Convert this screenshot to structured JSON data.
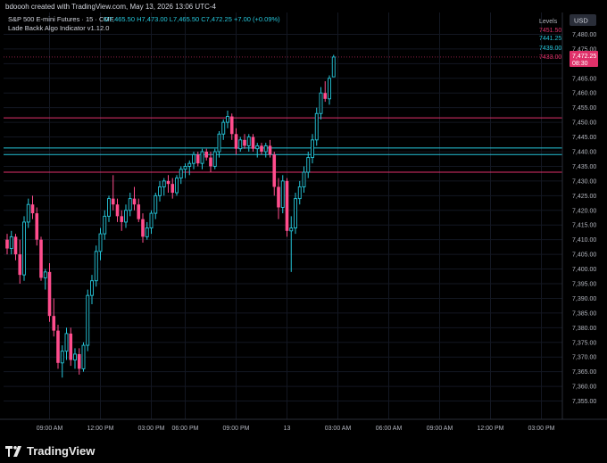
{
  "header": {
    "credit": "bdoooh created with TradingView.com, May 13, 2026 13:06 UTC-4"
  },
  "legend": {
    "symbol": "S&P 500 E-mini Futures · 15 · CME",
    "ohlc": "O7,465.50  H7,473.00  L7,465.50  C7,472.25  +7.00 (+0.09%)",
    "indicator": "Lade Backk Algo Indicator v1.12.0"
  },
  "scale": {
    "currency": "USD",
    "levels_title": "Levels"
  },
  "colors": {
    "up": "#26c6da",
    "down": "#ff4d8d",
    "magenta_level": "#e0316a",
    "teal_level": "#26c6da",
    "bg": "#000000"
  },
  "levels": [
    {
      "label": "7451.50",
      "value": 7451.5,
      "color": "#e0316a"
    },
    {
      "label": "7441.25",
      "value": 7441.25,
      "color": "#26c6da"
    },
    {
      "label": "7439.00",
      "value": 7439.0,
      "color": "#26c6da"
    },
    {
      "label": "7433.00",
      "value": 7433.0,
      "color": "#e0316a"
    }
  ],
  "last_price": {
    "label": "7,472.25",
    "countdown": "08:30"
  },
  "brand": {
    "name": "TradingView"
  },
  "chart_data": {
    "type": "candlestick",
    "ylim": [
      7350,
      7485
    ],
    "y_ticks": [
      7355,
      7360,
      7365,
      7370,
      7375,
      7380,
      7385,
      7390,
      7395,
      7400,
      7405,
      7410,
      7415,
      7420,
      7425,
      7430,
      7435,
      7440,
      7445,
      7450,
      7455,
      7460,
      7465,
      7470,
      7475,
      7480
    ],
    "y_tick_labels": [
      "7,355.00",
      "7,360.00",
      "7,365.00",
      "7,370.00",
      "7,375.00",
      "7,380.00",
      "7,385.00",
      "7,390.00",
      "7,395.00",
      "7,400.00",
      "7,405.00",
      "7,410.00",
      "7,415.00",
      "7,420.00",
      "7,425.00",
      "7,430.00",
      "7,435.00",
      "7,440.00",
      "7,445.00",
      "7,450.00",
      "7,455.00",
      "7,460.00",
      "7,465.00",
      "7,470.00",
      "7,475.00",
      "7,480.00"
    ],
    "x_ticks": [
      {
        "index": 10,
        "label": "09:00 AM"
      },
      {
        "index": 22,
        "label": "12:00 PM"
      },
      {
        "index": 34,
        "label": "03:00 PM"
      },
      {
        "index": 42,
        "label": "06:00 PM"
      },
      {
        "index": 54,
        "label": "09:00 PM"
      },
      {
        "index": 66,
        "label": "13"
      },
      {
        "index": 78,
        "label": "03:00 AM"
      },
      {
        "index": 90,
        "label": "06:00 AM"
      },
      {
        "index": 102,
        "label": "09:00 AM"
      },
      {
        "index": 114,
        "label": "12:00 PM"
      },
      {
        "index": 126,
        "label": "03:00 PM"
      }
    ],
    "candles": [
      [
        7410,
        7412,
        7405,
        7407
      ],
      [
        7407,
        7413,
        7405,
        7411
      ],
      [
        7411,
        7412,
        7403,
        7405
      ],
      [
        7405,
        7410,
        7395,
        7398
      ],
      [
        7398,
        7418,
        7396,
        7416
      ],
      [
        7416,
        7424,
        7414,
        7422
      ],
      [
        7422,
        7425,
        7417,
        7419
      ],
      [
        7419,
        7421,
        7408,
        7410
      ],
      [
        7410,
        7411,
        7396,
        7397
      ],
      [
        7397,
        7400,
        7393,
        7399
      ],
      [
        7399,
        7402,
        7382,
        7384
      ],
      [
        7384,
        7390,
        7377,
        7379
      ],
      [
        7379,
        7381,
        7366,
        7368
      ],
      [
        7368,
        7374,
        7363,
        7372
      ],
      [
        7372,
        7380,
        7369,
        7378
      ],
      [
        7378,
        7380,
        7367,
        7369
      ],
      [
        7369,
        7373,
        7366,
        7371
      ],
      [
        7371,
        7373,
        7364,
        7366
      ],
      [
        7366,
        7375,
        7365,
        7374
      ],
      [
        7374,
        7393,
        7372,
        7391
      ],
      [
        7391,
        7398,
        7388,
        7396
      ],
      [
        7396,
        7408,
        7394,
        7406
      ],
      [
        7406,
        7414,
        7403,
        7412
      ],
      [
        7412,
        7420,
        7410,
        7418
      ],
      [
        7418,
        7425,
        7416,
        7424
      ],
      [
        7424,
        7432,
        7420,
        7422
      ],
      [
        7422,
        7424,
        7416,
        7418
      ],
      [
        7418,
        7420,
        7413,
        7416
      ],
      [
        7416,
        7422,
        7414,
        7420
      ],
      [
        7420,
        7426,
        7418,
        7424
      ],
      [
        7424,
        7428,
        7420,
        7422
      ],
      [
        7422,
        7424,
        7416,
        7417
      ],
      [
        7417,
        7419,
        7409,
        7411
      ],
      [
        7411,
        7416,
        7410,
        7414
      ],
      [
        7414,
        7420,
        7412,
        7419
      ],
      [
        7419,
        7426,
        7417,
        7425
      ],
      [
        7425,
        7430,
        7423,
        7428
      ],
      [
        7428,
        7431,
        7425,
        7430
      ],
      [
        7430,
        7432,
        7426,
        7429
      ],
      [
        7429,
        7431,
        7424,
        7426
      ],
      [
        7426,
        7432,
        7425,
        7431
      ],
      [
        7431,
        7435,
        7429,
        7434
      ],
      [
        7434,
        7436,
        7431,
        7435
      ],
      [
        7435,
        7437,
        7432,
        7436
      ],
      [
        7436,
        7440,
        7434,
        7439
      ],
      [
        7439,
        7440,
        7435,
        7436
      ],
      [
        7436,
        7441,
        7434,
        7440
      ],
      [
        7440,
        7441,
        7437,
        7438
      ],
      [
        7438,
        7440,
        7433,
        7435
      ],
      [
        7435,
        7441,
        7434,
        7440
      ],
      [
        7440,
        7447,
        7438,
        7446
      ],
      [
        7446,
        7451,
        7444,
        7450
      ],
      [
        7450,
        7454,
        7448,
        7452
      ],
      [
        7452,
        7453,
        7444,
        7446
      ],
      [
        7446,
        7448,
        7439,
        7441
      ],
      [
        7441,
        7445,
        7440,
        7444
      ],
      [
        7444,
        7446,
        7441,
        7442
      ],
      [
        7442,
        7446,
        7440,
        7445
      ],
      [
        7445,
        7446,
        7440,
        7441
      ],
      [
        7441,
        7443,
        7438,
        7442
      ],
      [
        7442,
        7443,
        7439,
        7440
      ],
      [
        7440,
        7443,
        7438,
        7442
      ],
      [
        7442,
        7444,
        7438,
        7439
      ],
      [
        7439,
        7440,
        7425,
        7428
      ],
      [
        7428,
        7431,
        7417,
        7421
      ],
      [
        7421,
        7432,
        7419,
        7430
      ],
      [
        7430,
        7431,
        7411,
        7413
      ],
      [
        7413,
        7418,
        7399,
        7414
      ],
      [
        7414,
        7426,
        7412,
        7424
      ],
      [
        7424,
        7430,
        7422,
        7428
      ],
      [
        7428,
        7435,
        7426,
        7433
      ],
      [
        7433,
        7440,
        7431,
        7438
      ],
      [
        7438,
        7446,
        7436,
        7444
      ],
      [
        7444,
        7455,
        7442,
        7453
      ],
      [
        7453,
        7462,
        7451,
        7460
      ],
      [
        7460,
        7464,
        7457,
        7458
      ],
      [
        7458,
        7466,
        7456,
        7465
      ],
      [
        7465.5,
        7473,
        7465.5,
        7472.25
      ]
    ],
    "candle_x_index": [
      0,
      1,
      2,
      3,
      4,
      5,
      6,
      7,
      8,
      9,
      10,
      11,
      12,
      13,
      14,
      15,
      16,
      17,
      18,
      19,
      20,
      21,
      22,
      23,
      24,
      25,
      26,
      27,
      28,
      29,
      30,
      31,
      32,
      33,
      34,
      35,
      36,
      37,
      38,
      39,
      40,
      41,
      42,
      43,
      44,
      45,
      46,
      47,
      48,
      49,
      50,
      51,
      52,
      53,
      54,
      55,
      56,
      57,
      58,
      59,
      60,
      61,
      62,
      63,
      64,
      65,
      66,
      67,
      68,
      69,
      70,
      71,
      72,
      73,
      74,
      75,
      76,
      77
    ]
  }
}
